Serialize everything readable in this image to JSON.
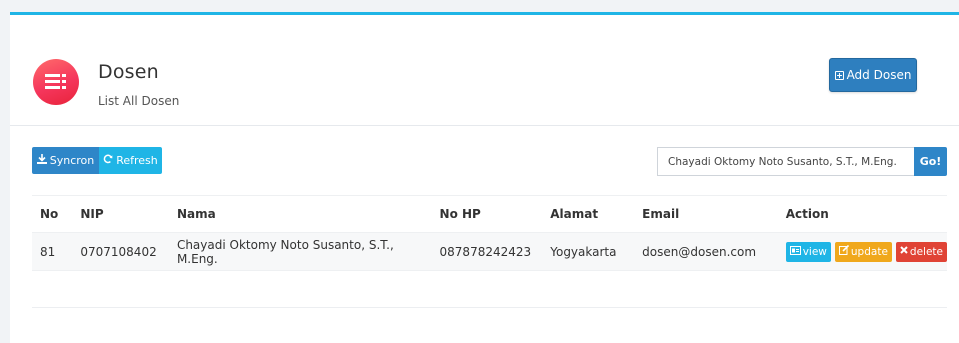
{
  "header": {
    "title": "Dosen",
    "subtitle": "List All Dosen",
    "add_button": "Add Dosen"
  },
  "toolbar": {
    "sync_label": "Syncron",
    "refresh_label": "Refresh"
  },
  "search": {
    "value": "Chayadi Oktomy Noto Susanto, S.T., M.Eng.",
    "go_label": "Go!"
  },
  "table": {
    "headers": [
      "No",
      "NIP",
      "Nama",
      "No HP",
      "Alamat",
      "Email",
      "Action"
    ],
    "rows": [
      {
        "no": "81",
        "nip": "0707108402",
        "nama": "Chayadi Oktomy Noto Susanto, S.T., M.Eng.",
        "hp": "087878242423",
        "alamat": "Yogyakarta",
        "email": "dosen@dosen.com",
        "actions": {
          "view": "view",
          "update": "update",
          "delete": "delete"
        }
      }
    ]
  },
  "colors": {
    "accent": "#1fb5e6",
    "primary": "#2e86c8",
    "warning": "#f0a81c",
    "danger": "#e04335"
  }
}
